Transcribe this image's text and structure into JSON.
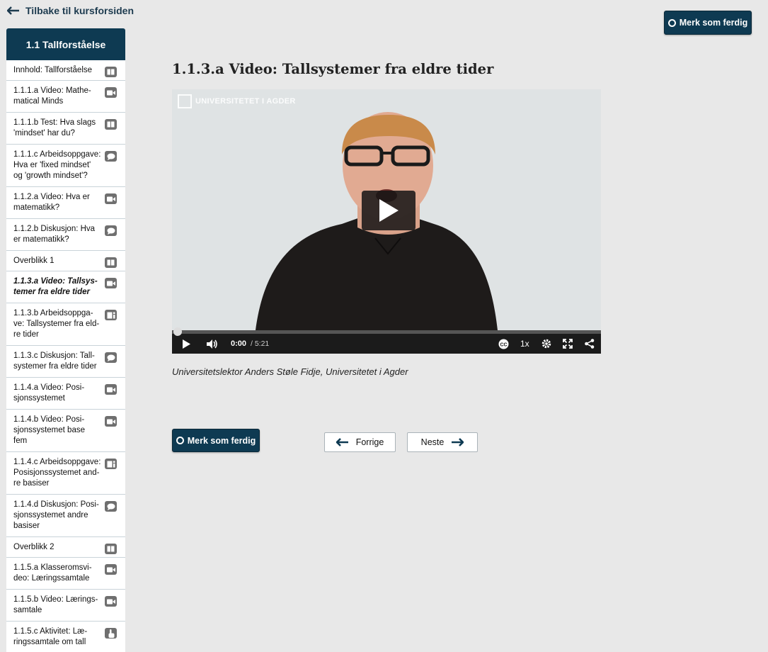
{
  "back_link": {
    "label": "Tilbake til kursforsiden",
    "icon": "arrow-left-icon"
  },
  "sidebar": {
    "title": "1.1 Tallforståelse",
    "items": [
      {
        "lines": [
          "Innhold: Tallforståelse"
        ],
        "icon": "book-icon",
        "active": false
      },
      {
        "lines": [
          "1.1.1.a Video: Mathe-",
          "matical Minds"
        ],
        "icon": "video-icon",
        "active": false
      },
      {
        "lines": [
          "1.1.1.b Test: Hva slags",
          "'mindset' har du?"
        ],
        "icon": "book-icon",
        "active": false
      },
      {
        "lines": [
          "1.1.1.c Arbeidsoppgave:",
          "Hva er 'fixed mindset'",
          "og 'growth mindset'?"
        ],
        "icon": "chat-icon",
        "active": false
      },
      {
        "lines": [
          "1.1.2.a Video: Hva er",
          "matematikk?"
        ],
        "icon": "video-icon",
        "active": false
      },
      {
        "lines": [
          "1.1.2.b Diskusjon: Hva",
          "er matematikk?"
        ],
        "icon": "chat-icon",
        "active": false
      },
      {
        "lines": [
          "Overblikk 1"
        ],
        "icon": "book-icon",
        "active": false
      },
      {
        "lines": [
          "1.1.3.a Video: Tallsys-",
          "temer fra eldre tider"
        ],
        "icon": "video-icon",
        "active": true
      },
      {
        "lines": [
          "1.1.3.b Arbeidsoppga-",
          "ve: Tallsystemer fra eld-",
          "re tider"
        ],
        "icon": "document-icon",
        "active": false
      },
      {
        "lines": [
          "1.1.3.c Diskusjon: Tall-",
          "systemer fra eldre tider"
        ],
        "icon": "chat-icon",
        "active": false
      },
      {
        "lines": [
          "1.1.4.a Video: Posi-",
          "sjonssystemet"
        ],
        "icon": "video-icon",
        "active": false
      },
      {
        "lines": [
          "1.1.4.b Video: Posi-",
          "sjonssystemet base",
          "fem"
        ],
        "icon": "video-icon",
        "active": false
      },
      {
        "lines": [
          "1.1.4.c Arbeidsoppgave:",
          "Posisjonssystemet and-",
          "re basiser"
        ],
        "icon": "document-icon",
        "active": false
      },
      {
        "lines": [
          "1.1.4.d Diskusjon: Posi-",
          "sjonssystemet andre",
          "basiser"
        ],
        "icon": "chat-icon",
        "active": false
      },
      {
        "lines": [
          "Overblikk 2"
        ],
        "icon": "book-icon",
        "active": false
      },
      {
        "lines": [
          "1.1.5.a Klasseromsvi-",
          "deo: Læringssamtale"
        ],
        "icon": "video-icon",
        "active": false
      },
      {
        "lines": [
          "1.1.5.b Video: Lærings-",
          "samtale"
        ],
        "icon": "video-icon",
        "active": false
      },
      {
        "lines": [
          "1.1.5.c Aktivitet: Læ-",
          "ringssamtale om tall"
        ],
        "icon": "hand-pointer-icon",
        "active": false
      }
    ]
  },
  "finish_button_top": {
    "label": "Merk som ferdig"
  },
  "page_title": "1.1.3.a Video: Tallsystemer fra eldre tider",
  "video": {
    "watermark": "UNIVERSITETET I AGDER",
    "current_time": "0:00",
    "duration": "/ 5:21",
    "speed": "1x",
    "progress": 0
  },
  "caption": "Universitetslektor Anders Støle Fidje, Universitetet i Agder",
  "finish_button_bottom": {
    "label": "Merk som ferdig"
  },
  "nav": {
    "prev_label": "Forrige",
    "next_label": "Neste"
  },
  "colors": {
    "primary": "#0e3a52",
    "active_marker": "#f07a1c",
    "background": "#e8e8e8"
  }
}
